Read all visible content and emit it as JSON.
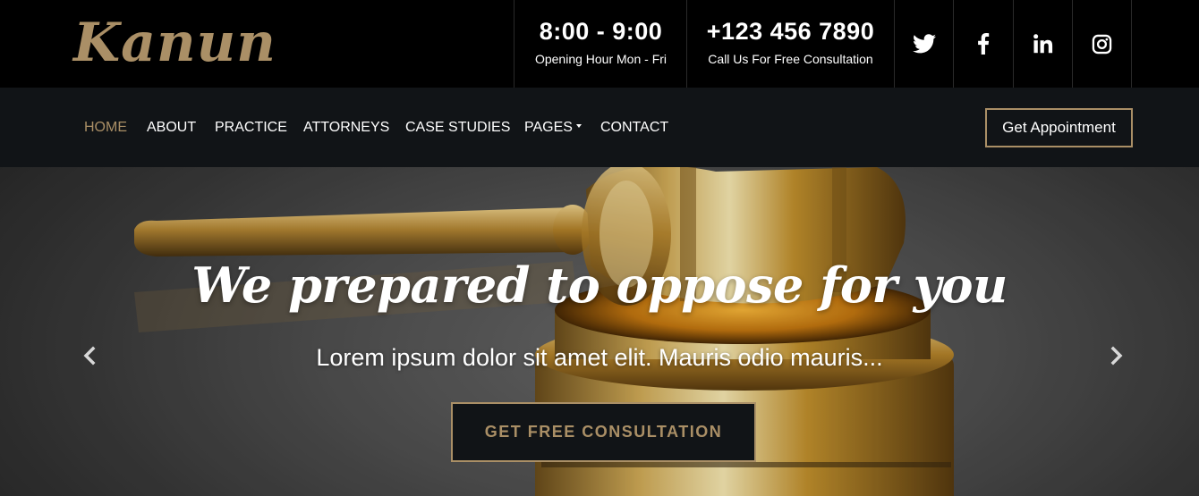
{
  "brand": {
    "logo_text": "Kanun",
    "accent_color": "#aa8f66"
  },
  "topbar": {
    "hours": {
      "time": "8:00 - 9:00",
      "label": "Opening Hour Mon - Fri"
    },
    "phone": {
      "number": "+123 456 7890",
      "label": "Call Us For Free Consultation"
    },
    "social": [
      {
        "icon": "twitter-icon"
      },
      {
        "icon": "facebook-icon"
      },
      {
        "icon": "linkedin-icon"
      },
      {
        "icon": "instagram-icon"
      }
    ]
  },
  "nav": {
    "items": [
      {
        "label": "HOME",
        "active": true
      },
      {
        "label": "ABOUT"
      },
      {
        "label": "PRACTICE"
      },
      {
        "label": "ATTORNEYS"
      },
      {
        "label": "CASE STUDIES"
      },
      {
        "label": "PAGES",
        "has_dropdown": true
      },
      {
        "label": "CONTACT"
      }
    ],
    "cta_label": "Get Appointment"
  },
  "hero": {
    "title": "We prepared to oppose for you",
    "subtitle": "Lorem ipsum dolor sit amet elit. Mauris odio mauris...",
    "cta_label": "GET FREE CONSULTATION",
    "background_image": "golden-gavel"
  }
}
